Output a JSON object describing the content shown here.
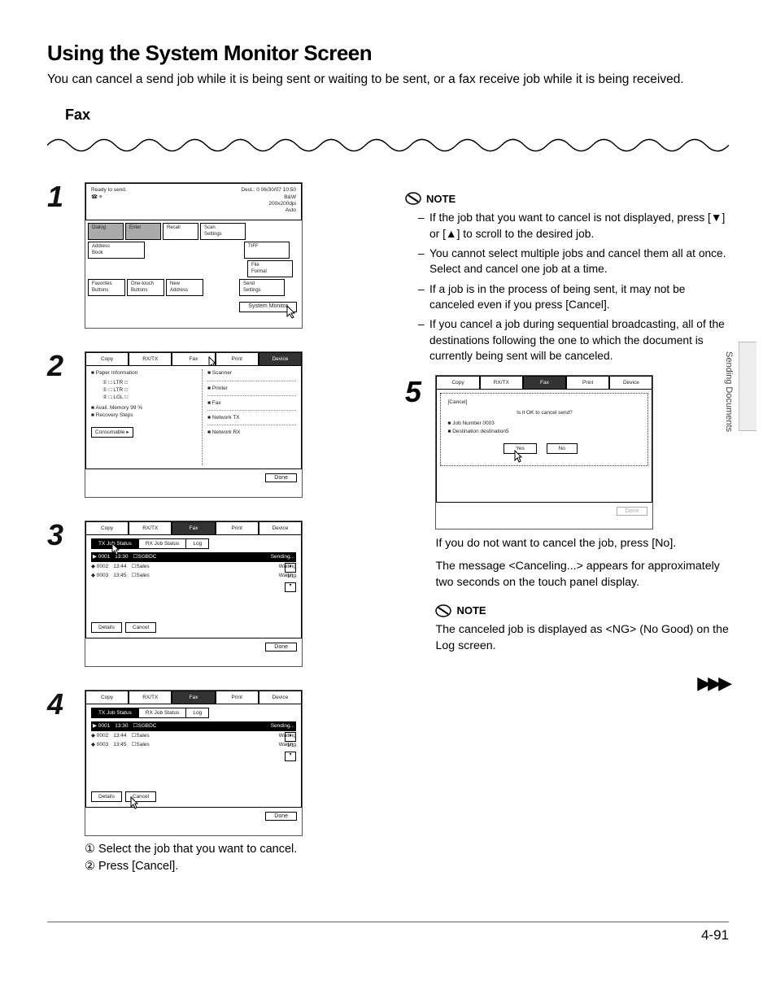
{
  "heading": "Using the System Monitor Screen",
  "intro": "You can cancel a send job while it is being sent or waiting to be sent, or a fax receive job while it is being received.",
  "section": "Fax",
  "side_label": "Sending Documents",
  "page_num": "4-91",
  "screens": {
    "s1": {
      "ready": "Ready to send.",
      "dest": "Dest.:   0",
      "datetime": "06/30/07 10:50",
      "right_lines": [
        "B&W",
        "200x200dpi",
        "Auto"
      ],
      "buttons_row1": [
        "Dialog",
        "Enter",
        "Recall",
        "Scan\nSettings"
      ],
      "addr": "Address\nBook",
      "tiff": "TIFF",
      "fileformat": "File\nFormat",
      "buttons_row2": [
        "Favorites\nButtons",
        "One-touch\nButtons",
        "New\nAddress",
        "Send\nSettings"
      ],
      "sysmon": "System Monitor"
    },
    "tabs": [
      "Copy",
      "RX/TX",
      "Fax",
      "Print",
      "Device"
    ],
    "s2": {
      "paper": "■ Paper Information",
      "lines": [
        "①  □ LTR   □",
        "①  □ LTR   □",
        "②  □ LGL   □"
      ],
      "avail": "■ Avail. Memory    99 %",
      "recov": "■ Recovery Steps",
      "right_items": [
        "■ Scanner",
        "■ Printer",
        "■ Fax",
        "■ Network TX",
        "■ Network RX"
      ],
      "consumable": "Consumable ▸",
      "done": "Done"
    },
    "sub_tabs": [
      "TX Job Status",
      "RX Job Status",
      "Log"
    ],
    "s3": {
      "rows": [
        {
          "id": "▶ 0001",
          "time": "13:30",
          "name": "SGBDC",
          "status": "Sending...",
          "hl": true
        },
        {
          "id": "◆ 0002",
          "time": "13:44",
          "name": "Sales",
          "status": "Waiting",
          "hl": false
        },
        {
          "id": "◆ 0003",
          "time": "13:45",
          "name": "Sales",
          "status": "Waiting",
          "hl": false
        }
      ],
      "frac": "1/1",
      "details": "Details",
      "cancel": "Cancel",
      "done": "Done"
    },
    "s4_caption1": "① Select the job that you want to cancel.",
    "s4_caption2": "② Press [Cancel].",
    "s5": {
      "dlg_title": "[Cancel]",
      "prompt": "Is it OK to cancel send?",
      "jobnum": "■ Job Number      0003",
      "dest": "■ Destination     destination5",
      "yes": "Yes",
      "no": "No",
      "done": "Done"
    }
  },
  "notes1_head": "NOTE",
  "notes1": [
    "If the job that you want to cancel is not displayed, press [▼] or [▲] to scroll to the desired job.",
    "You cannot select multiple jobs and cancel them all at once. Select and cancel one job at a time.",
    "If a job is in the process of being sent, it may not be canceled even if you press [Cancel].",
    "If you cancel a job during sequential broadcasting, all of the destinations following the one to which the document is currently being sent will be canceled."
  ],
  "after5_p1": "If you do not want to cancel the job, press [No].",
  "after5_p2": "The message <Canceling...> appears for approximately two seconds on the touch panel display.",
  "note2_head": "NOTE",
  "note2_body": "The canceled job is displayed as <NG> (No Good) on the Log screen."
}
